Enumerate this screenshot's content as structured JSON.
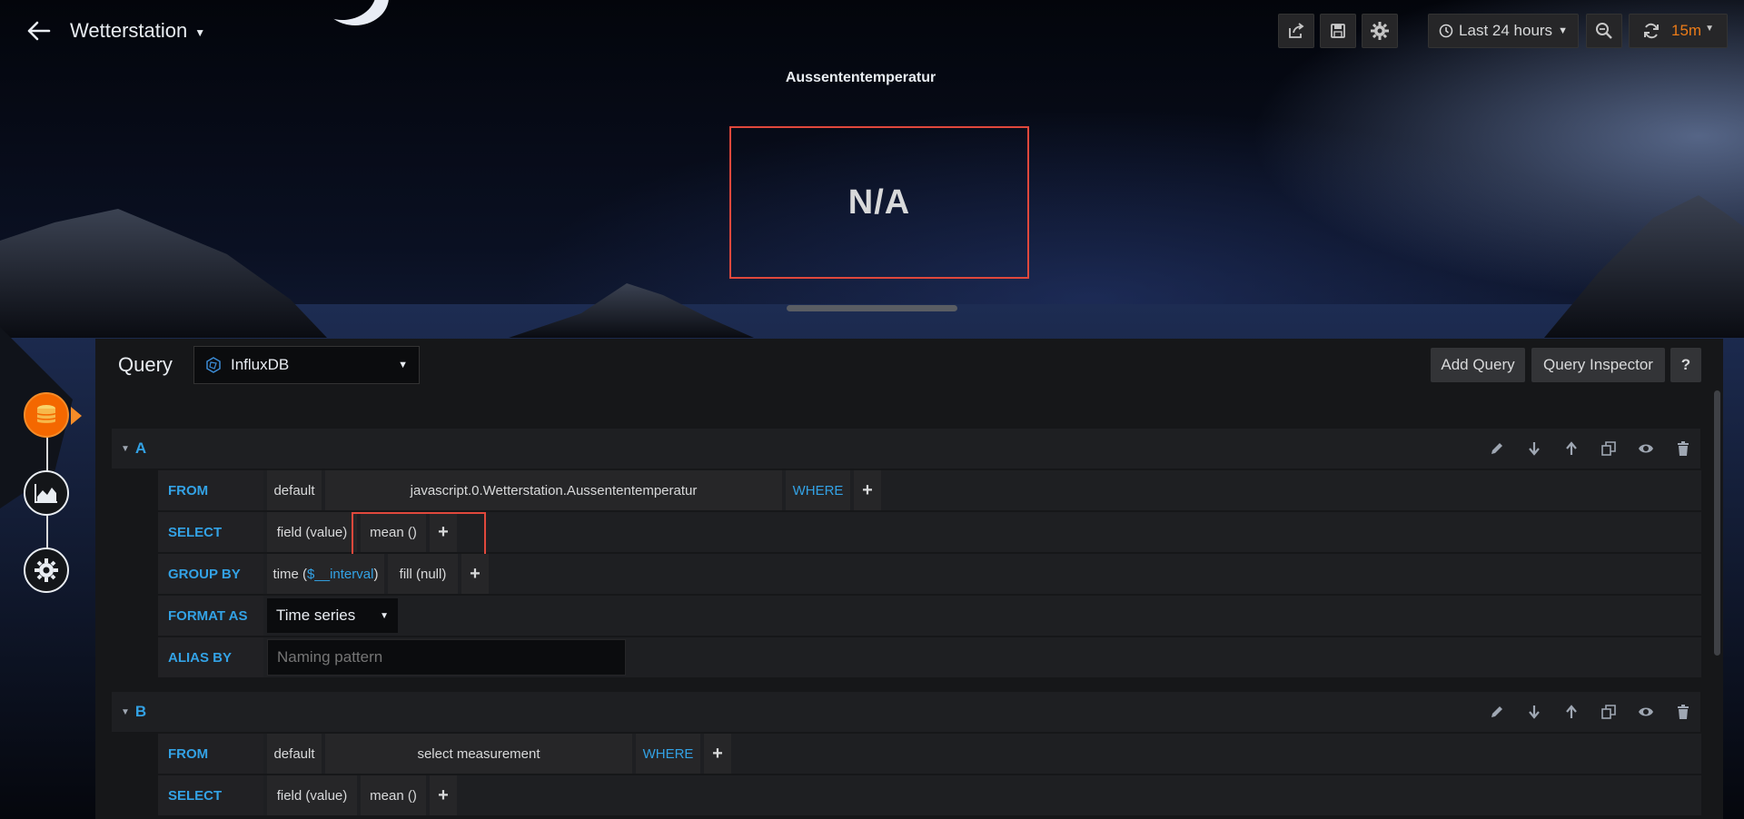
{
  "header": {
    "dashboard_title": "Wetterstation",
    "time_range": "Last 24 hours",
    "refresh_interval": "15m"
  },
  "panel": {
    "title": "Aussententemperatur",
    "value": "N/A"
  },
  "query_editor": {
    "title": "Query",
    "datasource": "InfluxDB",
    "add_query_label": "Add Query",
    "query_inspector_label": "Query Inspector",
    "help_label": "?",
    "queries": [
      {
        "ref": "A",
        "from_label": "FROM",
        "policy": "default",
        "measurement": "javascript.0.Wetterstation.Aussententemperatur",
        "where_label": "WHERE",
        "select_label": "SELECT",
        "field": "field (value)",
        "aggregation": "mean ()",
        "group_by_label": "GROUP BY",
        "group_time_prefix": "time (",
        "group_time_var": "$__interval",
        "group_time_suffix": ")",
        "fill": "fill (null)",
        "format_as_label": "FORMAT AS",
        "format": "Time series",
        "alias_by_label": "ALIAS BY",
        "alias_placeholder": "Naming pattern"
      },
      {
        "ref": "B",
        "from_label": "FROM",
        "policy": "default",
        "measurement": "select measurement",
        "where_label": "WHERE",
        "select_label": "SELECT",
        "field": "field (value)",
        "aggregation": "mean ()"
      }
    ]
  },
  "colors": {
    "accent_blue": "#33a2e5",
    "accent_orange": "#eb7b18",
    "highlight_red": "#e0483c"
  }
}
